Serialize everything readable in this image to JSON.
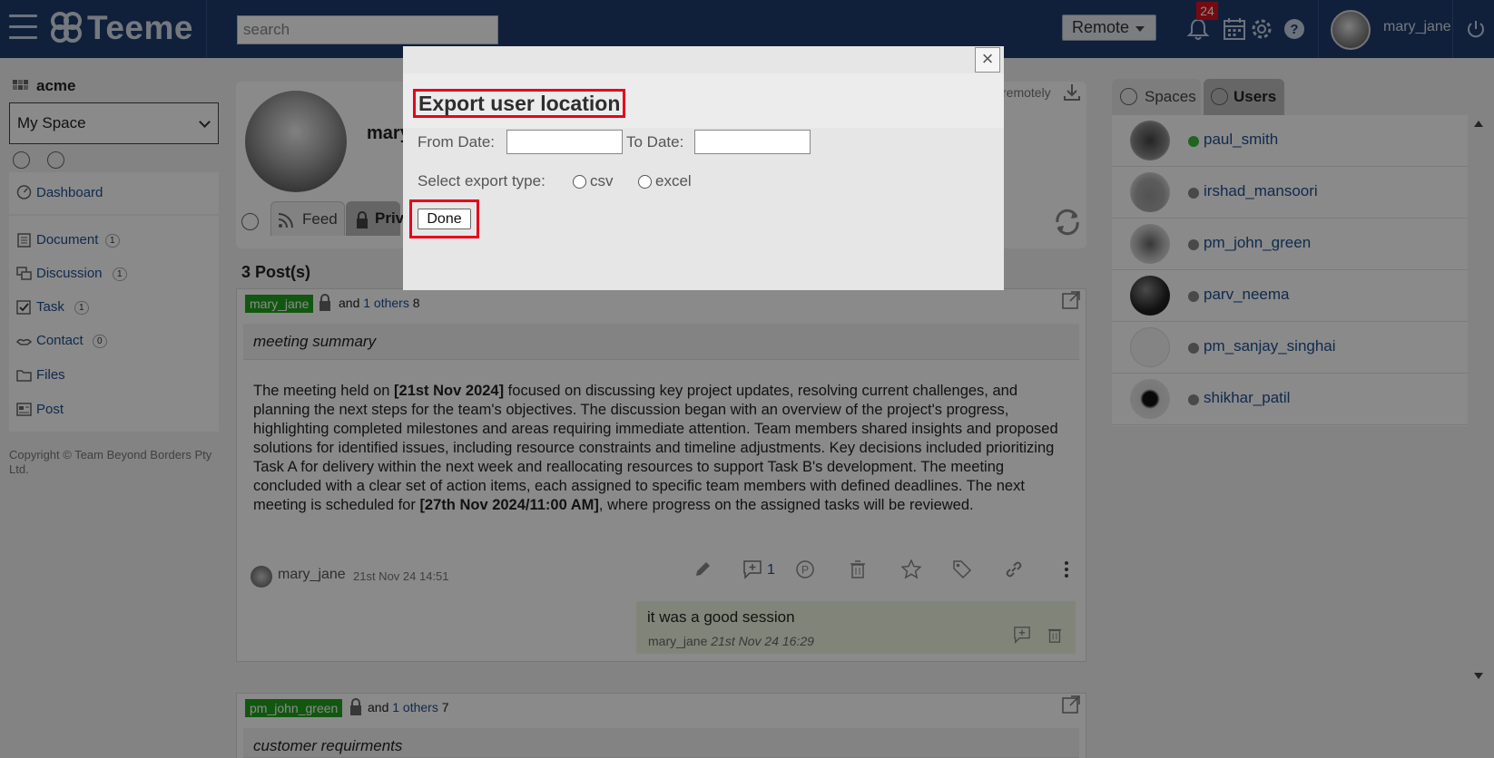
{
  "app": {
    "brand": "Teeme",
    "search_placeholder": "search",
    "mode_label": "Remote",
    "notification_count": "24",
    "username": "mary_jane"
  },
  "sidebar": {
    "org_name": "acme",
    "space_selected": "My Space",
    "items": [
      {
        "label": "Dashboard",
        "count": ""
      },
      {
        "label": "Document",
        "count": "1"
      },
      {
        "label": "Discussion",
        "count": "1"
      },
      {
        "label": "Task",
        "count": "1"
      },
      {
        "label": "Contact",
        "count": "0"
      },
      {
        "label": "Files",
        "count": ""
      },
      {
        "label": "Post",
        "count": ""
      }
    ],
    "copyright": "Copyright © Team Beyond Borders Pty Ltd."
  },
  "profile": {
    "name_partial": "mary",
    "remotely_label": "remotely",
    "tab_feed": "Feed",
    "tab_private": "Priv"
  },
  "feed": {
    "posts_count": "3 Post(s)",
    "posts": [
      {
        "owner": "mary_jane",
        "and_text": "and",
        "others_link": "1 others",
        "others_count": "8",
        "title": "meeting summary",
        "body_parts": [
          "The meeting held on ",
          "[21st Nov 2024]",
          " focused on discussing key project updates, resolving current challenges, and planning the next steps for the team's objectives. The discussion began with an overview of the project's progress, highlighting completed milestones and areas requiring immediate attention. Team members shared insights and proposed solutions for identified issues, including resource constraints and timeline adjustments. Key decisions included prioritizing Task A for delivery within the next week and reallocating resources to support Task B's development. The meeting concluded with a clear set of action items, each assigned to specific team members with defined deadlines. The next meeting is scheduled for ",
          "[27th Nov 2024/11:00 AM]",
          ", where progress on the assigned tasks will be reviewed."
        ],
        "author": "mary_jane",
        "date": "21st Nov 24 14:51",
        "comment_count": "1",
        "comment": {
          "text": "it was a good session",
          "author": "mary_jane",
          "date": "21st Nov 24 16:29"
        }
      },
      {
        "owner": "pm_john_green",
        "and_text": "and",
        "others_link": "1 others",
        "others_count": "7",
        "title": "customer requirments"
      }
    ]
  },
  "users_panel": {
    "tab_spaces": "Spaces",
    "tab_users": "Users",
    "users": [
      {
        "name": "paul_smith",
        "online": true
      },
      {
        "name": "irshad_mansoori",
        "online": false
      },
      {
        "name": "pm_john_green",
        "online": false
      },
      {
        "name": "parv_neema",
        "online": false
      },
      {
        "name": "pm_sanjay_singhai",
        "online": false
      },
      {
        "name": "shikhar_patil",
        "online": false
      }
    ]
  },
  "modal": {
    "title": "Export user location",
    "close_label": "×",
    "from_date_label": "From Date:",
    "to_date_label": "To Date:",
    "from_date_value": "",
    "to_date_value": "",
    "export_type_label": "Select export type:",
    "option_csv": "csv",
    "option_excel": "excel",
    "done_label": "Done"
  },
  "colors": {
    "topbar": "#1f3c6e",
    "highlight": "#e8001c",
    "tag_green": "#22a11e",
    "link": "#1f4f8f"
  }
}
